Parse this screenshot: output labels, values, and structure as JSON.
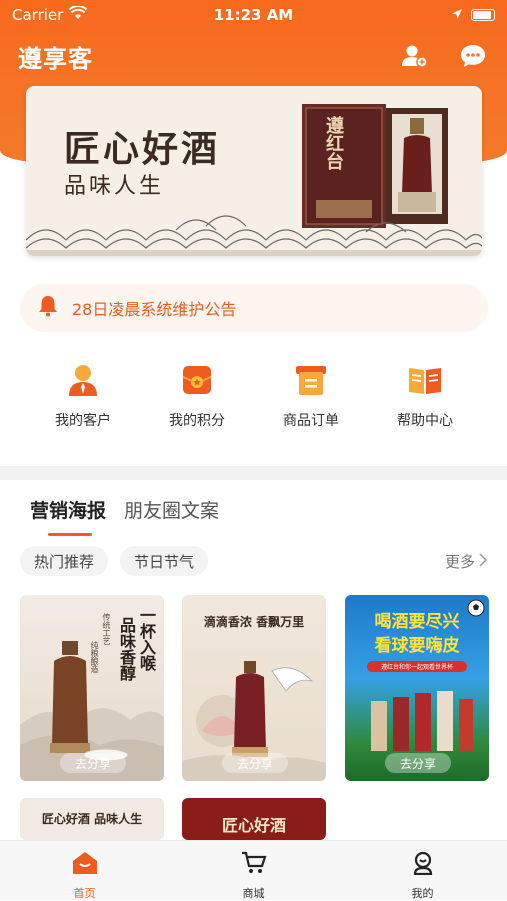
{
  "status": {
    "carrier": "Carrier",
    "time": "11:23 AM"
  },
  "header": {
    "title": "遵享客"
  },
  "banner": {
    "title": "匠心好酒",
    "subtitle": "品味人生",
    "brand_mark": "遵红台"
  },
  "notice": {
    "text": "28日凌晨系统维护公告"
  },
  "quick_actions": [
    {
      "label": "我的客户",
      "icon": "customer-icon"
    },
    {
      "label": "我的积分",
      "icon": "points-icon"
    },
    {
      "label": "商品订单",
      "icon": "order-icon"
    },
    {
      "label": "帮助中心",
      "icon": "help-book-icon"
    }
  ],
  "tabs": [
    {
      "label": "营销海报"
    },
    {
      "label": "朋友圈文案"
    }
  ],
  "chips": [
    {
      "label": "热门推荐"
    },
    {
      "label": "节日节气"
    }
  ],
  "more_label": "更多",
  "posters": [
    {
      "share": "去分享",
      "headline": "一杯入喉",
      "headline2": "品味香醇",
      "small1": "传统工艺",
      "small2": "纯粮酿造"
    },
    {
      "share": "去分享",
      "headline": "滴滴香浓 香飘万里"
    },
    {
      "share": "去分享",
      "headline": "喝酒要尽兴",
      "headline2": "看球要嗨皮",
      "small1": "遵红台和你一起观看世界杯"
    },
    {
      "headline": "匠心好酒 品味人生"
    },
    {
      "headline": "匠心好酒"
    }
  ],
  "tabbar": [
    {
      "label": "首页"
    },
    {
      "label": "商城"
    },
    {
      "label": "我的"
    }
  ],
  "colors": {
    "accent": "#f05b1f",
    "header": "#f86a1e"
  }
}
